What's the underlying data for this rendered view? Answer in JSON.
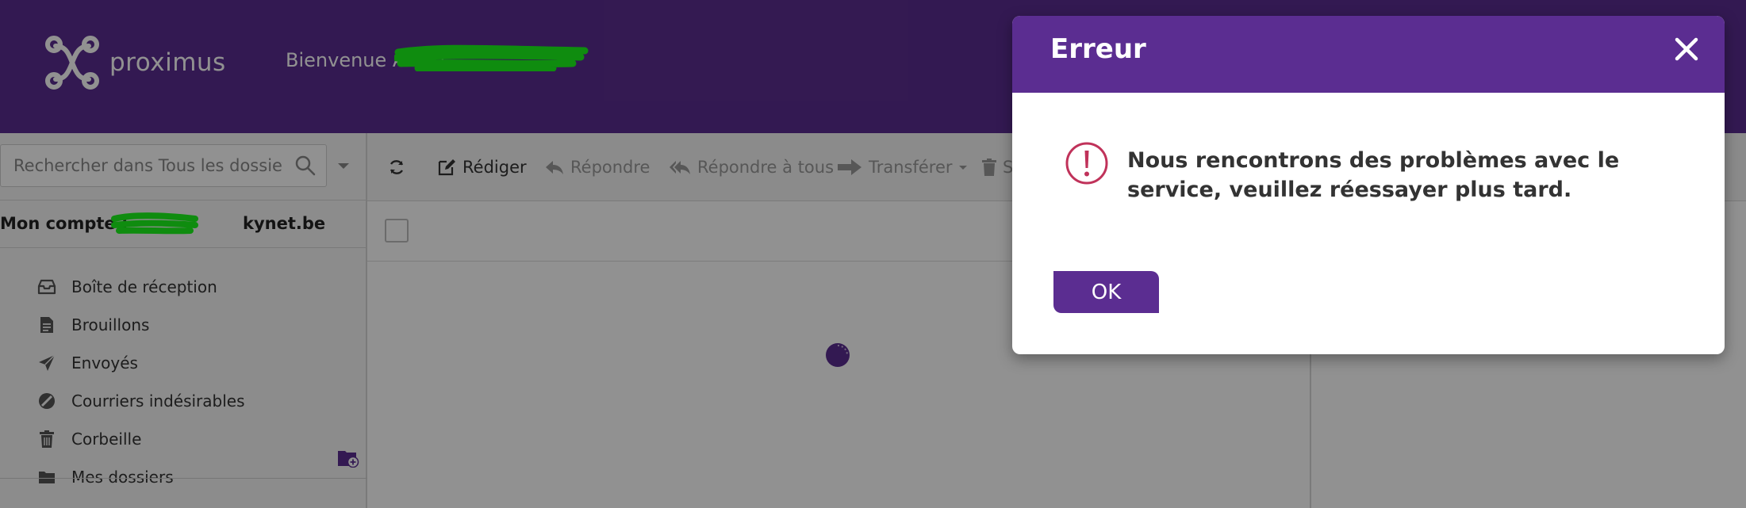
{
  "header": {
    "logo_text": "proximus",
    "welcome": "Bienvenue Alexa"
  },
  "sidebar": {
    "search_placeholder": "Rechercher dans Tous les dossiers",
    "account_label": "Mon compte :",
    "account_domain": "kynet.be",
    "folders": [
      {
        "label": "Boîte de réception",
        "icon": "inbox-icon"
      },
      {
        "label": "Brouillons",
        "icon": "draft-icon"
      },
      {
        "label": "Envoyés",
        "icon": "send-icon"
      },
      {
        "label": "Courriers indésirables",
        "icon": "spam-icon"
      },
      {
        "label": "Corbeille",
        "icon": "trash-icon"
      },
      {
        "label": "Mes dossiers",
        "icon": "folder-icon"
      }
    ]
  },
  "toolbar": {
    "compose": "Rédiger",
    "reply": "Répondre",
    "reply_all": "Répondre à tous",
    "forward": "Transférer",
    "delete_partial": "S"
  },
  "modal": {
    "title": "Erreur",
    "message": "Nous rencontrons des problèmes avec le service, veuillez réessayer plus tard.",
    "ok": "OK"
  },
  "colors": {
    "brand": "#5b2d91",
    "alert": "#c0325a",
    "redaction": "#1cf71c"
  }
}
